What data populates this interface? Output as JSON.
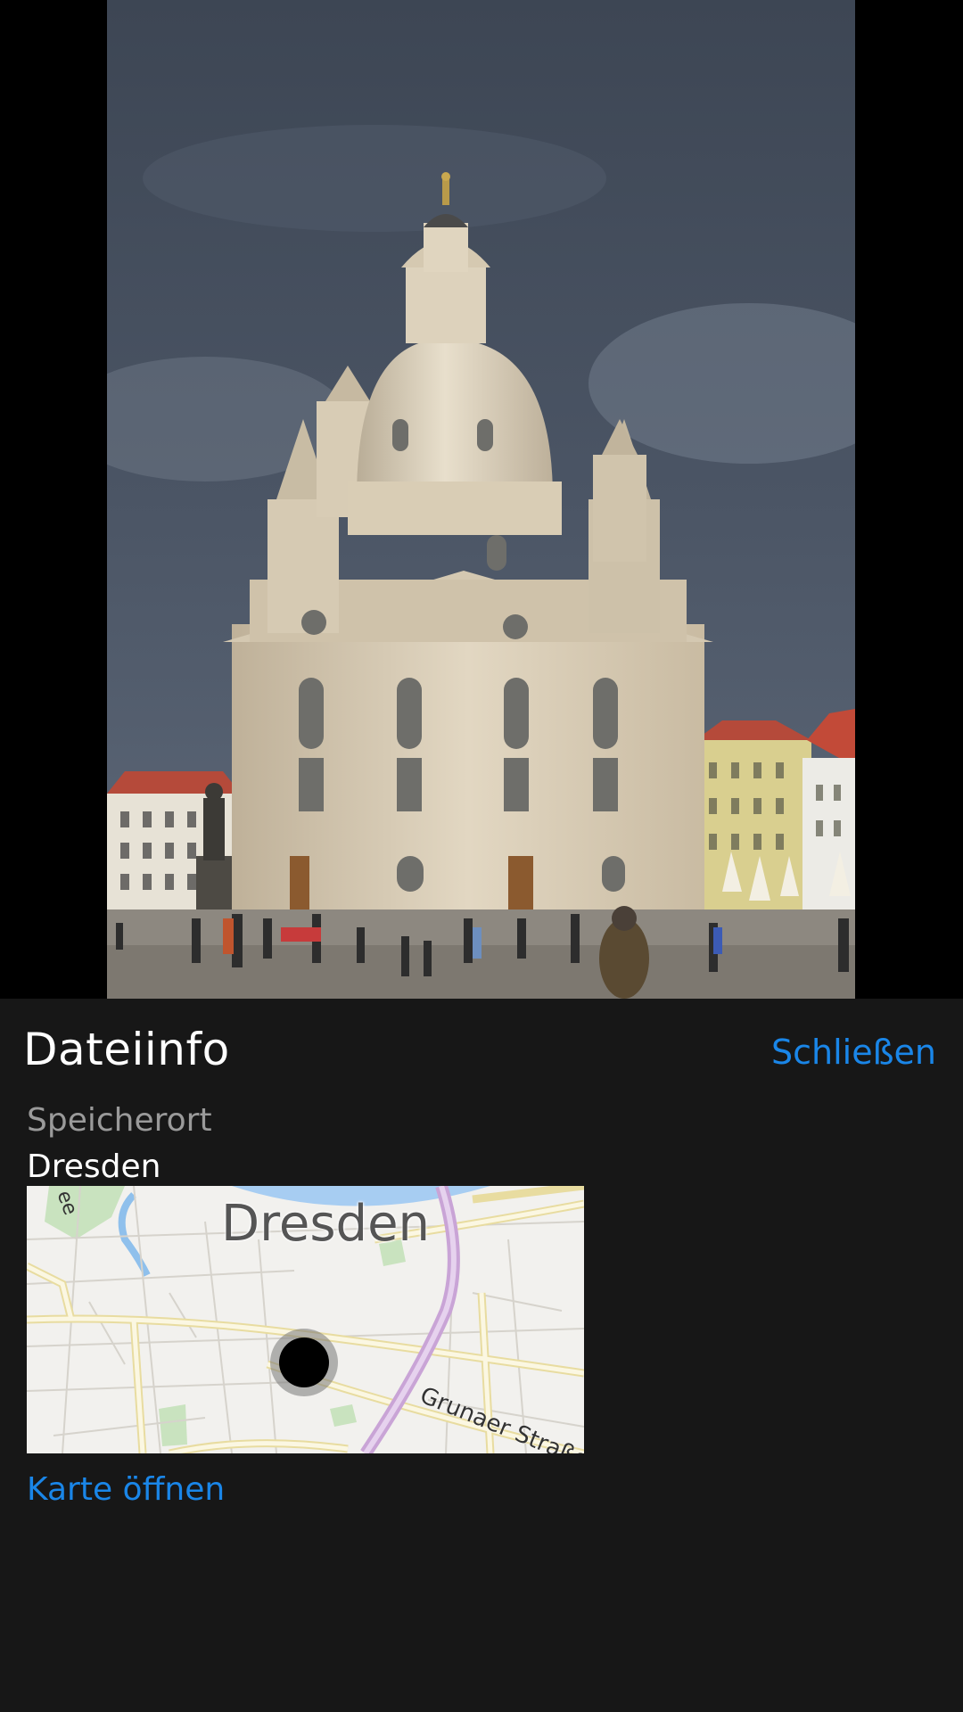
{
  "photo": {
    "subject": "church-photo"
  },
  "file_info": {
    "title": "Dateiinfo",
    "close_label": "Schließen",
    "location_label": "Speicherort",
    "location_value": "Dresden",
    "open_map_label": "Karte öffnen"
  },
  "map": {
    "city_label": "Dresden",
    "street_label": "Grunaer Straße",
    "corner_label": "ee"
  },
  "colors": {
    "panel_bg": "#171717",
    "accent": "#1a86e8",
    "secondary_text": "#9a9a9a"
  }
}
